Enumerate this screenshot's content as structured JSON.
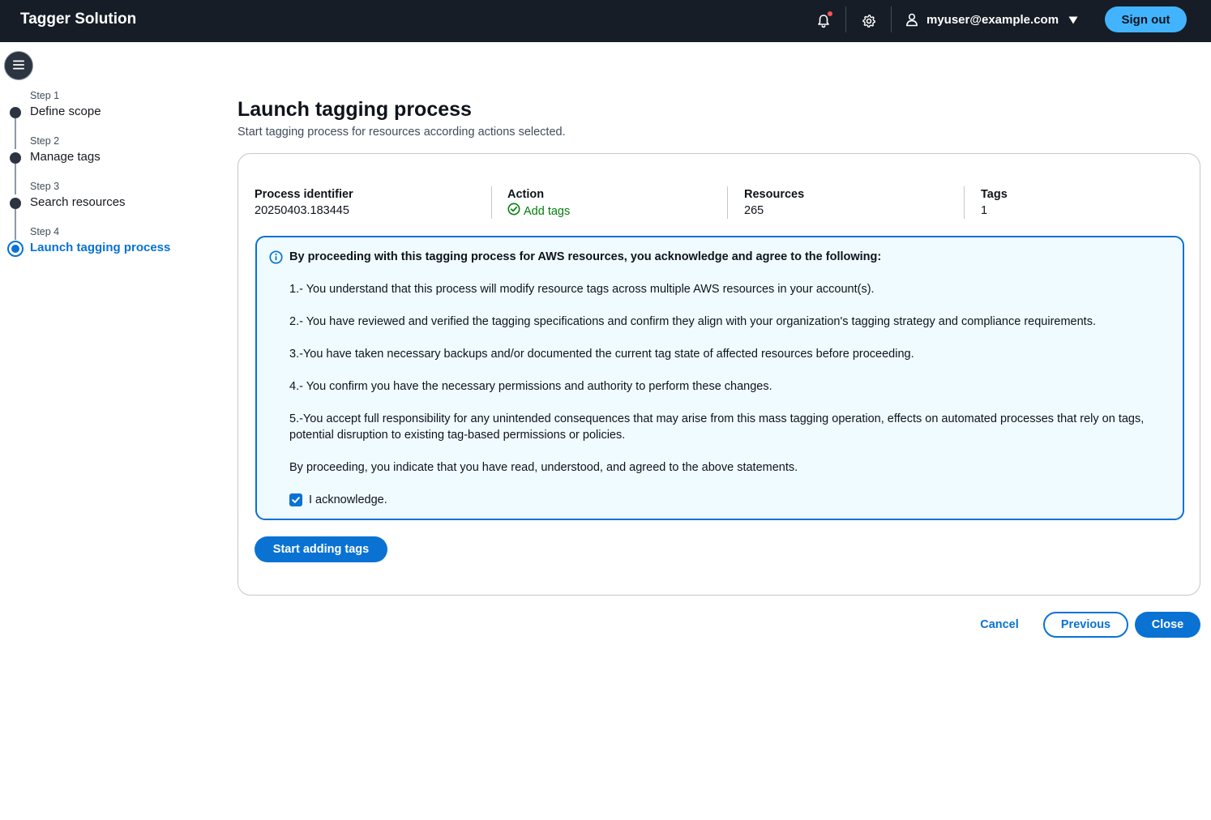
{
  "app": {
    "title": "Tagger Solution"
  },
  "header": {
    "notifications_icon": "bell-icon",
    "notification_badge_color": "#f95550",
    "settings_icon": "gear-icon",
    "user_icon": "user-icon",
    "user_email": "myuser@example.com",
    "sign_out_label": "Sign out"
  },
  "sidebar": {
    "toggle_icon": "hamburger-menu-icon",
    "steps": [
      {
        "number": "Step 1",
        "title": "Define scope",
        "state": "completed"
      },
      {
        "number": "Step 2",
        "title": "Manage tags",
        "state": "completed"
      },
      {
        "number": "Step 3",
        "title": "Search resources",
        "state": "completed"
      },
      {
        "number": "Step 4",
        "title": "Launch tagging process",
        "state": "active"
      }
    ]
  },
  "main": {
    "title": "Launch tagging process",
    "description": "Start tagging process for resources according actions selected.",
    "summary": {
      "process_identifier": {
        "label": "Process identifier",
        "value": "20250403.183445"
      },
      "action": {
        "label": "Action",
        "value": "Add tags",
        "status": "success"
      },
      "resources": {
        "label": "Resources",
        "value": "265"
      },
      "tags": {
        "label": "Tags",
        "value": "1"
      }
    },
    "acknowledgement": {
      "header": "By proceeding with this tagging process for AWS resources, you acknowledge and agree to the following:",
      "items": [
        "1.- You understand that this process will modify resource tags across multiple AWS resources in your account(s).",
        "2.- You have reviewed and verified the tagging specifications and confirm they align with your organization's tagging strategy and compliance requirements.",
        "3.-You have taken necessary backups and/or documented the current tag state of affected resources before proceeding.",
        "4.- You confirm you have the necessary permissions and authority to perform these changes.",
        "5.-You accept full responsibility for any unintended consequences that may arise from this mass tagging operation, effects on automated processes that rely on tags, potential disruption to existing tag-based permissions or policies."
      ],
      "closing": "By proceeding, you indicate that you have read, understood, and agreed to the above statements.",
      "checkbox_label": "I acknowledge.",
      "checked": true
    },
    "start_button_label": "Start adding tags"
  },
  "footer": {
    "cancel_label": "Cancel",
    "previous_label": "Previous",
    "close_label": "Close"
  },
  "colors": {
    "accent": "#0972d3",
    "nav_background": "#161d26",
    "sign_out": "#42b4ff",
    "success": "#037f0c",
    "alert_background": "#f0fbff"
  }
}
